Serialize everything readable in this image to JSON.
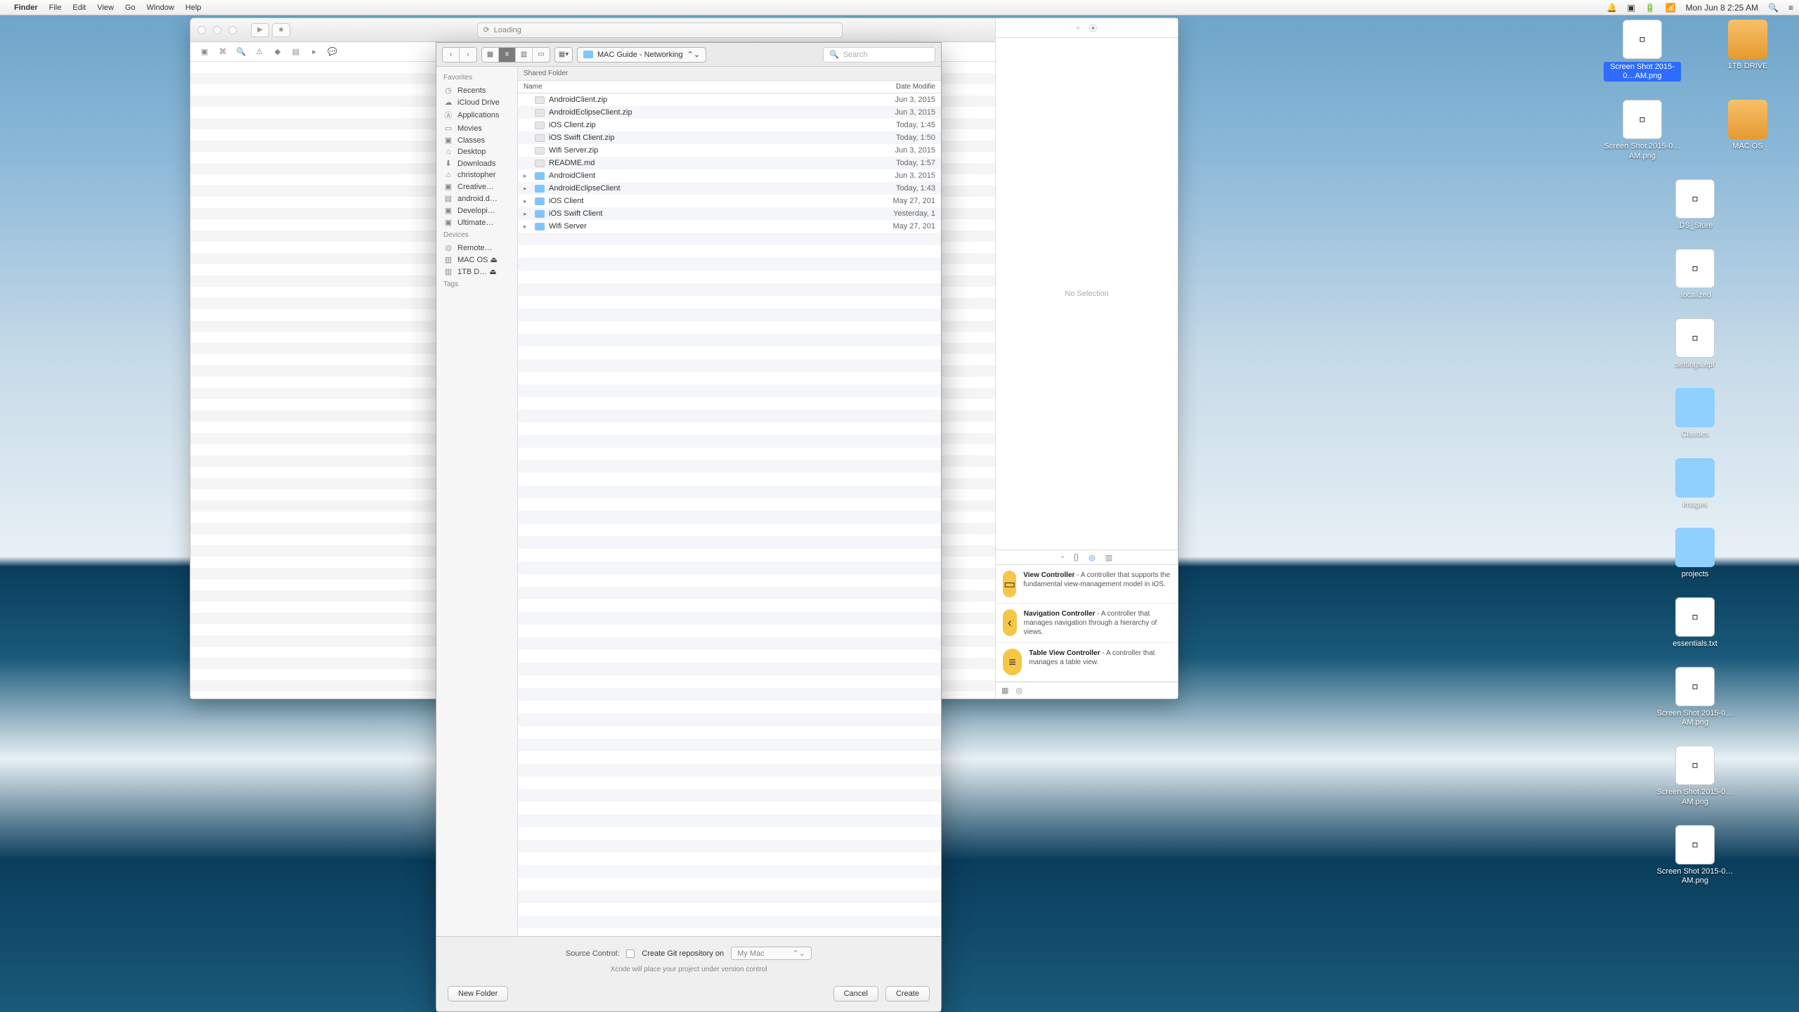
{
  "menubar": {
    "app": "Finder",
    "items": [
      "File",
      "Edit",
      "View",
      "Go",
      "Window",
      "Help"
    ],
    "right": {
      "clock": "Mon Jun 8  2:25 AM"
    }
  },
  "finder": {
    "title": "Loading",
    "no_selection": "No Selection",
    "library": [
      {
        "name": "View Controller",
        "desc": " - A controller that supports the fundamental view-management model in iOS.",
        "color": "#f6c646",
        "glyph": "▭"
      },
      {
        "name": "Navigation Controller",
        "desc": " - A controller that manages navigation through a hierarchy of views.",
        "color": "#f6c646",
        "glyph": "‹"
      },
      {
        "name": "Table View Controller",
        "desc": " - A controller that manages a table view.",
        "color": "#f6c646",
        "glyph": "≡"
      }
    ]
  },
  "sheet": {
    "path": "MAC Guide - Networking",
    "shared_folder": "Shared Folder",
    "columns": {
      "name": "Name",
      "date": "Date Modifie"
    },
    "search_placeholder": "Search",
    "sidebar": {
      "favorites": "Favorites",
      "fav_items": [
        {
          "i": "◷",
          "l": "Recents"
        },
        {
          "i": "☁",
          "l": "iCloud Drive"
        },
        {
          "i": "Ⓐ",
          "l": "Applications"
        },
        {
          "i": "▭",
          "l": "Movies"
        },
        {
          "i": "▣",
          "l": "Classes"
        },
        {
          "i": "⌂",
          "l": "Desktop"
        },
        {
          "i": "⬇",
          "l": "Downloads"
        },
        {
          "i": "⌂",
          "l": "christopher"
        },
        {
          "i": "▣",
          "l": "Creative…"
        },
        {
          "i": "▤",
          "l": "android.d…"
        },
        {
          "i": "▣",
          "l": "Developi…"
        },
        {
          "i": "▣",
          "l": "Ultimate…"
        }
      ],
      "devices": "Devices",
      "dev_items": [
        {
          "i": "◎",
          "l": "Remote…"
        },
        {
          "i": "▥",
          "l": "MAC OS   ⏏"
        },
        {
          "i": "▥",
          "l": "1TB D…   ⏏"
        }
      ],
      "tags": "Tags"
    },
    "files": [
      {
        "t": "file",
        "n": "AndroidClient.zip",
        "d": "Jun 3, 2015"
      },
      {
        "t": "file",
        "n": "AndroidEclipseClient.zip",
        "d": "Jun 3, 2015"
      },
      {
        "t": "file",
        "n": "iOS Client.zip",
        "d": "Today, 1:45"
      },
      {
        "t": "file",
        "n": "iOS Swift Client.zip",
        "d": "Today, 1:50"
      },
      {
        "t": "file",
        "n": "Wifi Server.zip",
        "d": "Jun 3, 2015"
      },
      {
        "t": "file",
        "n": "README.md",
        "d": "Today, 1:57"
      },
      {
        "t": "folder",
        "n": "AndroidClient",
        "d": "Jun 3, 2015"
      },
      {
        "t": "folder",
        "n": "AndroidEclipseClient",
        "d": "Today, 1:43"
      },
      {
        "t": "folder",
        "n": "iOS Client",
        "d": "May 27, 201"
      },
      {
        "t": "folder",
        "n": "iOS Swift Client",
        "d": "Yesterday, 1"
      },
      {
        "t": "folder",
        "n": "Wifi Server",
        "d": "May 27, 201"
      }
    ],
    "source_control_label": "Source Control:",
    "git_label": "Create Git repository on",
    "git_location": "My Mac",
    "git_hint": "Xcode will place your project under version control",
    "new_folder": "New Folder",
    "cancel": "Cancel",
    "create": "Create"
  },
  "desktop": [
    {
      "k": "png",
      "l": "Screen Shot 2015-0…AM.png",
      "sel": true
    },
    {
      "k": "drive",
      "l": "1TB DRIVE"
    },
    {
      "k": "png",
      "l": "Screen Shot 2015-0…AM.png"
    },
    {
      "k": "drive",
      "l": "MAC OS"
    },
    {
      "k": "file",
      "l": ".DS_Store",
      "full": true
    },
    {
      "k": "file",
      "l": ".localized",
      "full": true
    },
    {
      "k": "file",
      "l": "settings.epf",
      "full": true
    },
    {
      "k": "folder",
      "l": "Classes",
      "full": true
    },
    {
      "k": "folder",
      "l": "images",
      "full": true
    },
    {
      "k": "folder",
      "l": "projects",
      "full": true
    },
    {
      "k": "file",
      "l": "essentials.txt",
      "full": true
    },
    {
      "k": "png",
      "l": "Screen Shot 2015-0…AM.png",
      "full": true
    },
    {
      "k": "png",
      "l": "Screen Shot 2015-0…AM.png",
      "full": true
    },
    {
      "k": "png",
      "l": "Screen Shot 2015-0…AM.png",
      "full": true
    }
  ]
}
